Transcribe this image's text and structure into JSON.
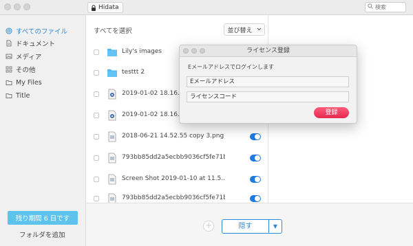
{
  "app": {
    "title": "Hidata"
  },
  "search": {
    "placeholder": "検索"
  },
  "sidebar": {
    "items": [
      {
        "label": "すべてのファイル",
        "icon": "all-files-icon",
        "active": true
      },
      {
        "label": "ドキュメント",
        "icon": "document-icon"
      },
      {
        "label": "メディア",
        "icon": "media-icon"
      },
      {
        "label": "その他",
        "icon": "grid-icon"
      },
      {
        "label": "My Files",
        "icon": "folder-icon"
      },
      {
        "label": "Title",
        "icon": "folder-icon"
      }
    ],
    "period_label": "残り期間 6 日です",
    "add_folder_label": "フォルダを追加"
  },
  "filelist": {
    "select_all": "すべてを選択",
    "sort_label": "並び替え",
    "files": [
      {
        "name": "Lily's images",
        "type": "folder"
      },
      {
        "name": "testtt 2",
        "type": "folder"
      },
      {
        "name": "2019-01-02 18.16.50 2",
        "type": "image-file"
      },
      {
        "name": "2019-01-02 18.16.50 2",
        "type": "image-file"
      },
      {
        "name": "2018-06-21 14.52.55 copy 3.png",
        "type": "file",
        "toggle": true
      },
      {
        "name": "793bb85dd2a5ecbb9036cf5fe71bdb...",
        "type": "file",
        "toggle": true
      },
      {
        "name": "Screen Shot 2019-01-10 at 11.5...",
        "type": "file",
        "toggle": true
      },
      {
        "name": "793bb85dd2a5ecbb9036cf5fe71bdb...",
        "type": "file",
        "toggle": true
      }
    ]
  },
  "bottombar": {
    "hide_label": "隠す"
  },
  "dialog": {
    "title": "ライセンス登録",
    "prompt": "Eメールアドレスでログインします",
    "email_placeholder": "Eメールアドレス",
    "license_placeholder": "ライセンスコード",
    "register_label": "登録"
  },
  "colors": {
    "accent": "#2d8ad8",
    "period_button": "#5ec3ec",
    "register_button": "#e8284f",
    "toggle_on": "#1f7ae0"
  }
}
